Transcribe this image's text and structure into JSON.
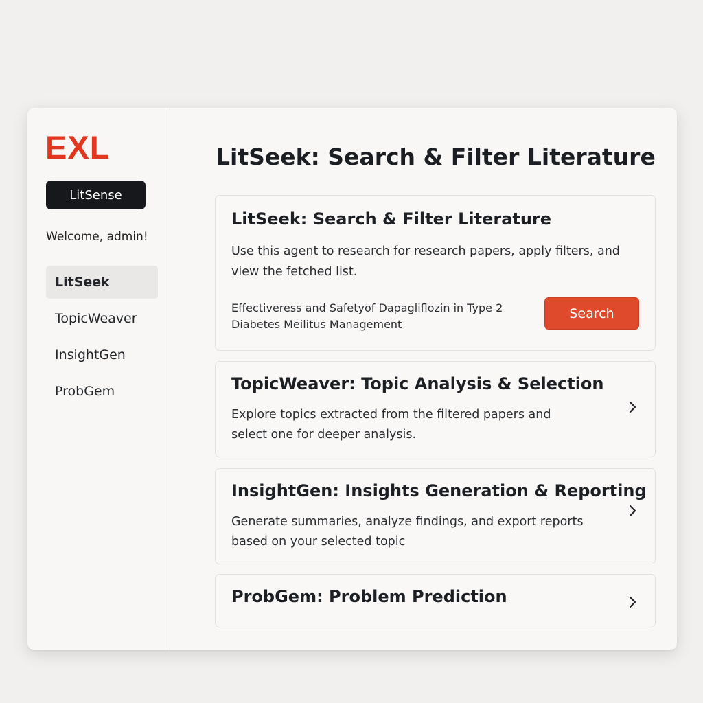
{
  "sidebar": {
    "logo": "EXL",
    "app_name": "LitSense",
    "welcome": "Welcome, admin!",
    "items": [
      {
        "label": "LitSeek",
        "active": true
      },
      {
        "label": "TopicWeaver",
        "active": false
      },
      {
        "label": "InsightGen",
        "active": false
      },
      {
        "label": "ProbGem",
        "active": false
      }
    ]
  },
  "main": {
    "title": "LitSeek: Search & Filter Literature",
    "cards": [
      {
        "title": "LitSeek: Search & Filter Literature",
        "description": "Use this agent to research for research papers, apply filters, and view the fetched list.",
        "query": "Effectiveress and Safetyof Dapagliflozin in Type 2 Diabetes Meilitus Management",
        "button_label": "Search"
      },
      {
        "title": "TopicWeaver: Topic Analysis & Selection",
        "description": "Explore topics extracted from the filtered papers and select one for deeper analysis."
      },
      {
        "title": "InsightGen: Insights Generation & Reporting",
        "description": "Generate summaries, analyze findings, and export reports based on your selected topic"
      },
      {
        "title": "ProbGem: Problem Prediction"
      }
    ]
  },
  "colors": {
    "brand": "#e2361f",
    "accent_button": "#e04a2c",
    "badge_bg": "#16181b"
  },
  "icons": {
    "chevron": "chevron-right-icon"
  }
}
